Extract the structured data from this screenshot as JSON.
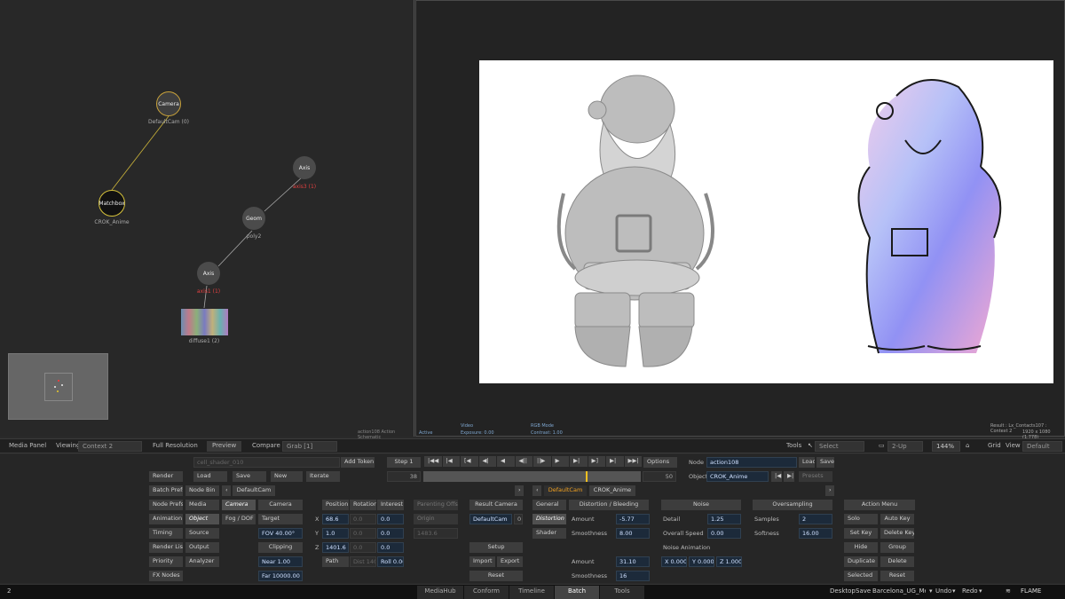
{
  "schematic": {
    "nodes": {
      "camera": {
        "title": "Camera",
        "label": "DefaultCam (0)"
      },
      "matchbox": {
        "title": "Matchbox",
        "label": "CROK_Anime"
      },
      "axis3": {
        "title": "Axis",
        "label": "axis3 (1)"
      },
      "geom": {
        "title": "Geom",
        "label": "poly2"
      },
      "axis1": {
        "title": "Axis",
        "label": "axis1 (1)"
      },
      "diffuse": {
        "label": "diffuse1 (2)"
      }
    },
    "footer": "action108 Action Schematic"
  },
  "viewer": {
    "status_active": "Active",
    "video_label": "Video",
    "exposure": "Exposure: 0.00",
    "rgb_mode": "RGB Mode",
    "contrast": "Contrast: 1.00",
    "result_info": "Result : Lx_Contacts107 : Context 2",
    "resolution": "1920 x 1080 (1.778)"
  },
  "toolbar": {
    "media_panel": "Media Panel",
    "viewing": "Viewing",
    "context": "Context 2",
    "full_resolution": "Full Resolution",
    "preview": "Preview",
    "compare": "Compare",
    "grab": "Grab [1]",
    "tools": "Tools",
    "select": "Select",
    "layout": "2-Up",
    "zoom": "144%",
    "grid": "Grid",
    "view": "View",
    "view_value": "Default"
  },
  "panel": {
    "shader_name": "cell_shader_010",
    "add_token": "Add Token",
    "step": "Step 1",
    "options": "Options",
    "node_label": "Node",
    "node_value": "action108",
    "load": "Load",
    "save": "Save",
    "object_label": "Object",
    "object_value": "CROK_Anime",
    "presets": "Presets",
    "frame_start": "38",
    "frame_end": "50",
    "render": "Render",
    "load_btn": "Load",
    "save_btn": "Save",
    "new_btn": "New",
    "iterate": "Iterate",
    "batch_prefs": "Batch Prefs",
    "node_bin": "Node Bin",
    "default_cam_tab": "DefaultCam",
    "default_cam_tab2": "DefaultCam",
    "crok_tab": "CROK_Anime",
    "left_menu": [
      "Node Prefs",
      "Animation",
      "Timing",
      "Render List",
      "Priority",
      "FX Nodes"
    ],
    "mid_menu": [
      "Media",
      "Object",
      "Source",
      "Output",
      "Analyzer"
    ],
    "cam_menu": [
      "Camera",
      "Fog / DOF"
    ],
    "camera_btn": "Camera",
    "target_btn": "Target",
    "fov": "FOV 40.00°",
    "clipping": "Clipping",
    "near": "Near 1.00",
    "far": "Far 10000.00",
    "position": "Position",
    "rotation": "Rotation",
    "interest": "Interest",
    "axis_x": "X",
    "axis_y": "Y",
    "axis_z": "Z",
    "pos_x": "68.6",
    "pos_y": "1.0",
    "pos_z": "1401.6",
    "rot_x": "0.0",
    "rot_y": "0.0",
    "rot_z": "0.0",
    "int_x": "0.0",
    "int_y": "0.0",
    "int_z": "0.0",
    "path": "Path",
    "dist": "Dist 1403",
    "roll": "Roll 0.00",
    "parenting_offset": "Parenting Offset",
    "origin": "Origin",
    "dist_value": "1483.6",
    "result_camera": "Result Camera",
    "result_cam_value": "DefaultCam",
    "result_cam_num": "0",
    "setup": "Setup",
    "import": "Import",
    "export": "Export",
    "reset": "Reset",
    "general": "General",
    "distortion": "Distortion",
    "shader": "Shader",
    "distortion_bleeding": "Distortion / Bleeding",
    "amount_label": "Amount",
    "amount_value": "-5.77",
    "smoothness_label": "Smoothness",
    "smoothness_value": "8.00",
    "noise_amount_label": "Amount",
    "noise_amount_value": "31.10",
    "noise_smooth_label": "Smoothness",
    "noise_smooth_value": "16",
    "noise": "Noise",
    "detail_label": "Detail",
    "detail_value": "1.25",
    "overall_speed_label": "Overall Speed",
    "overall_speed_value": "0.00",
    "noise_animation": "Noise Animation",
    "nx": "X 0.000",
    "ny": "Y 0.000",
    "nz": "Z 1.000",
    "oversampling": "Oversampling",
    "samples_label": "Samples",
    "samples_value": "2",
    "softness_label": "Softness",
    "softness_value": "16.00",
    "action_menu": "Action Menu",
    "solo": "Solo",
    "auto_key": "Auto Key",
    "set_key": "Set Key",
    "delete_key": "Delete Key",
    "hide": "Hide",
    "group": "Group",
    "duplicate": "Duplicate",
    "delete": "Delete",
    "selected": "Selected",
    "reset2": "Reset"
  },
  "bottombar": {
    "tabs": [
      "MediaHub",
      "Conform",
      "Timeline",
      "Batch",
      "Tools"
    ],
    "desktop": "Desktop",
    "save": "Save",
    "project": "Barcelona_UG_Meetin",
    "undo": "Undo",
    "redo": "Redo",
    "brand": "FLAME",
    "page_num": "2"
  }
}
